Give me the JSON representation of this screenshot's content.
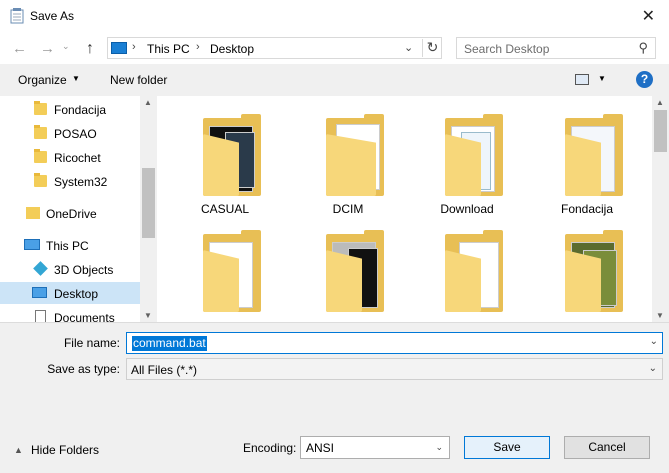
{
  "window": {
    "title": "Save As",
    "close_glyph": "✕"
  },
  "nav": {
    "back_glyph": "←",
    "forward_glyph": "→",
    "recent_glyph": "⌄",
    "up_glyph": "↑",
    "breadcrumb": [
      "This PC",
      "Desktop"
    ],
    "separator_glyph": "›",
    "dropdown_glyph": "⌄",
    "refresh_glyph": "↻",
    "search_placeholder": "Search Desktop",
    "search_glyph": "⚲"
  },
  "toolbar": {
    "organize_label": "Organize",
    "new_folder_label": "New folder",
    "dropdown_glyph": "▼",
    "help_glyph": "?"
  },
  "sidebar": {
    "items": [
      {
        "label": "Fondacija",
        "icon": "folder-icon"
      },
      {
        "label": "POSAO",
        "icon": "folder-icon"
      },
      {
        "label": "Ricochet",
        "icon": "folder-icon"
      },
      {
        "label": "System32",
        "icon": "folder-icon"
      },
      {
        "label": "OneDrive",
        "icon": "onedrive-icon"
      },
      {
        "label": "This PC",
        "icon": "this-pc-icon"
      },
      {
        "label": "3D Objects",
        "icon": "3d-objects-icon"
      },
      {
        "label": "Desktop",
        "icon": "desktop-icon",
        "selected": true
      },
      {
        "label": "Documents",
        "icon": "documents-icon"
      }
    ],
    "scroll_up_glyph": "▲",
    "scroll_down_glyph": "▼"
  },
  "files": [
    {
      "label": "CASUAL"
    },
    {
      "label": "DCIM"
    },
    {
      "label": "Download"
    },
    {
      "label": "Fondacija"
    },
    {
      "label": ""
    },
    {
      "label": ""
    },
    {
      "label": ""
    },
    {
      "label": ""
    }
  ],
  "form": {
    "file_name_label": "File name:",
    "file_name_value": "command.bat",
    "save_as_type_label": "Save as type:",
    "save_as_type_value": "All Files  (*.*)",
    "dropdown_glyph": "⌄"
  },
  "footer": {
    "hide_folders_label": "Hide Folders",
    "hide_folders_glyph": "▲",
    "encoding_label": "Encoding:",
    "encoding_value": "ANSI",
    "dropdown_glyph": "⌄",
    "save_label": "Save",
    "cancel_label": "Cancel"
  },
  "colors": {
    "selection_blue": "#0078d7",
    "sidebar_selected": "#cce4f7",
    "folder_yellow": "#f3cd58",
    "pane_gray": "#f0f0f0"
  }
}
